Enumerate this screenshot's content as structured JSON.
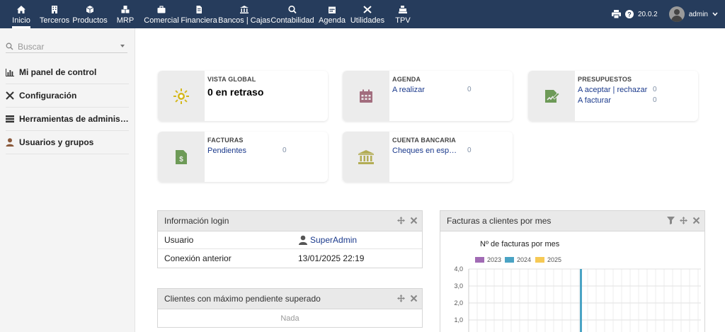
{
  "nav": {
    "items": [
      {
        "label": "Inicio",
        "icon": "home-icon"
      },
      {
        "label": "Terceros",
        "icon": "building-icon"
      },
      {
        "label": "Productos",
        "icon": "cube-icon"
      },
      {
        "label": "MRP",
        "icon": "cubes-icon"
      },
      {
        "label": "Comercial",
        "icon": "briefcase-icon"
      },
      {
        "label": "Financiera",
        "icon": "file-invoice-icon"
      },
      {
        "label": "Bancos | Cajas",
        "icon": "bank-icon"
      },
      {
        "label": "Contabilidad",
        "icon": "search-dollar-icon"
      },
      {
        "label": "Agenda",
        "icon": "calendar-icon"
      },
      {
        "label": "Utilidades",
        "icon": "tools-icon"
      },
      {
        "label": "TPV",
        "icon": "cash-register-icon"
      }
    ],
    "version": "20.0.2",
    "user": "admin"
  },
  "sidebar": {
    "search_placeholder": "Buscar",
    "items": [
      {
        "label": "Mi panel de control",
        "icon": "chart-icon"
      },
      {
        "label": "Configuración",
        "icon": "tools-icon"
      },
      {
        "label": "Herramientas de administración",
        "icon": "server-icon"
      },
      {
        "label": "Usuarios y grupos",
        "icon": "user-icon"
      }
    ]
  },
  "boxes": {
    "vista": {
      "title": "VISTA GLOBAL",
      "value": "0 en retraso"
    },
    "agenda": {
      "title": "AGENDA",
      "rows": [
        {
          "label": "A realizar",
          "count": "0"
        }
      ]
    },
    "presupuestos": {
      "title": "PRESUPUESTOS",
      "rows": [
        {
          "label": "A aceptar | rechazar",
          "count": "0"
        },
        {
          "label": "A facturar",
          "count": "0"
        }
      ]
    },
    "facturas": {
      "title": "FACTURAS",
      "rows": [
        {
          "label": "Pendientes",
          "count": "0"
        }
      ]
    },
    "cuenta": {
      "title": "CUENTA BANCARIA",
      "rows": [
        {
          "label": "Cheques en espera de depósito",
          "count": "0"
        }
      ]
    }
  },
  "login_panel": {
    "title": "Información login",
    "rows": [
      {
        "label": "Usuario",
        "value": "SuperAdmin"
      },
      {
        "label": "Conexión anterior",
        "value": "13/01/2025 22:19"
      }
    ]
  },
  "clientes_panel": {
    "title": "Clientes con máximo pendiente superado",
    "empty": "Nada"
  },
  "chart_panel": {
    "title": "Facturas a clientes por mes"
  },
  "colors": {
    "topbar": "#263c5c",
    "link": "#1b3a8c",
    "vista_icon": "#d4b81c",
    "agenda_icon": "#a26d7e",
    "presupuestos_icon": "#6d9a57",
    "facturas_icon": "#6d9a57",
    "banco_icon": "#b3ad55"
  },
  "chart_data": {
    "type": "bar",
    "title": "Nº de facturas por mes",
    "series": [
      {
        "name": "2023",
        "color": "#a16bb4",
        "values": []
      },
      {
        "name": "2024",
        "color": "#4aa3c4",
        "values": []
      },
      {
        "name": "2025",
        "color": "#f6c955",
        "values": []
      }
    ],
    "y_ticks": [
      "4,0",
      "3,0",
      "2,0",
      "1,0"
    ],
    "ylim": [
      0,
      4
    ],
    "grid": true
  }
}
